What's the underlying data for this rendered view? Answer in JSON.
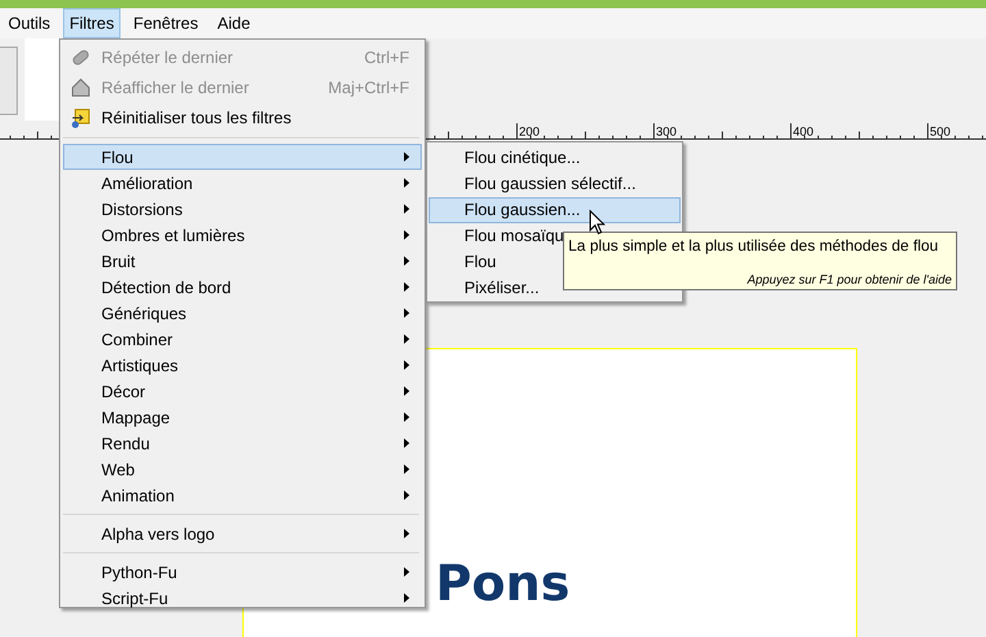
{
  "menubar": [
    {
      "label": "Outils",
      "selected": false
    },
    {
      "label": "Filtres",
      "selected": true
    },
    {
      "label": "Fenêtres",
      "selected": false
    },
    {
      "label": "Aide",
      "selected": false
    }
  ],
  "ruler": {
    "labels": [
      "200",
      "300",
      "400",
      "500"
    ]
  },
  "canvas": {
    "text": "Pons"
  },
  "menu": {
    "items": [
      {
        "kind": "action",
        "label": "Répéter le dernier",
        "shortcut": "Ctrl+F",
        "disabled": true
      },
      {
        "kind": "action",
        "label": "Réafficher le dernier",
        "shortcut": "Maj+Ctrl+F",
        "disabled": true
      },
      {
        "kind": "action",
        "label": "Réinitialiser tous les filtres",
        "disabled": false
      },
      {
        "kind": "separator"
      },
      {
        "kind": "submenu",
        "label": "Flou",
        "selected": true
      },
      {
        "kind": "submenu",
        "label": "Amélioration",
        "selected": false
      },
      {
        "kind": "submenu",
        "label": "Distorsions",
        "selected": false
      },
      {
        "kind": "submenu",
        "label": "Ombres et lumières",
        "selected": false
      },
      {
        "kind": "submenu",
        "label": "Bruit",
        "selected": false
      },
      {
        "kind": "submenu",
        "label": "Détection de bord",
        "selected": false
      },
      {
        "kind": "submenu",
        "label": "Génériques",
        "selected": false
      },
      {
        "kind": "submenu",
        "label": "Combiner",
        "selected": false
      },
      {
        "kind": "submenu",
        "label": "Artistiques",
        "selected": false
      },
      {
        "kind": "submenu",
        "label": "Décor",
        "selected": false
      },
      {
        "kind": "submenu",
        "label": "Mappage",
        "selected": false
      },
      {
        "kind": "submenu",
        "label": "Rendu",
        "selected": false
      },
      {
        "kind": "submenu",
        "label": "Web",
        "selected": false
      },
      {
        "kind": "submenu",
        "label": "Animation",
        "selected": false
      },
      {
        "kind": "separator"
      },
      {
        "kind": "submenu",
        "label": "Alpha vers logo",
        "selected": false
      },
      {
        "kind": "separator"
      },
      {
        "kind": "submenu",
        "label": "Python-Fu",
        "selected": false
      },
      {
        "kind": "submenu",
        "label": "Script-Fu",
        "selected": false
      }
    ]
  },
  "submenu": {
    "items": [
      {
        "label": "Flou cinétique...",
        "selected": false
      },
      {
        "label": "Flou gaussien sélectif...",
        "selected": false
      },
      {
        "label": "Flou gaussien...",
        "selected": true
      },
      {
        "label": "Flou mosaïqu",
        "selected": false
      },
      {
        "label": "Flou",
        "selected": false
      },
      {
        "label": "Pixéliser...",
        "selected": false
      }
    ]
  },
  "tooltip": {
    "text": "La plus simple et la plus utilisée des méthodes de flou",
    "hint": "Appuyez sur F1 pour obtenir de l'aide"
  }
}
